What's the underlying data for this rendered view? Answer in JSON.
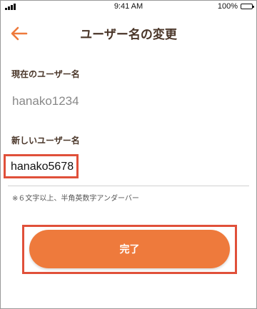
{
  "status_bar": {
    "time": "9:41 AM",
    "battery": "100%",
    "icons": [
      "signal-icon",
      "battery-icon"
    ]
  },
  "header": {
    "title": "ユーザー名の変更",
    "back_icon": "arrow-left-icon"
  },
  "current_username": {
    "label": "現在のユーザー名",
    "value": "hanako1234"
  },
  "new_username": {
    "label": "新しいユーザー名",
    "value": "hanako5678",
    "hint": "※６文字以上、半角英数字アンダーバー"
  },
  "done_button": {
    "label": "完了"
  },
  "colors": {
    "accent": "#ee7a3c",
    "highlight": "#e0503a",
    "title_text": "#4a3629",
    "muted_text": "#888888"
  }
}
